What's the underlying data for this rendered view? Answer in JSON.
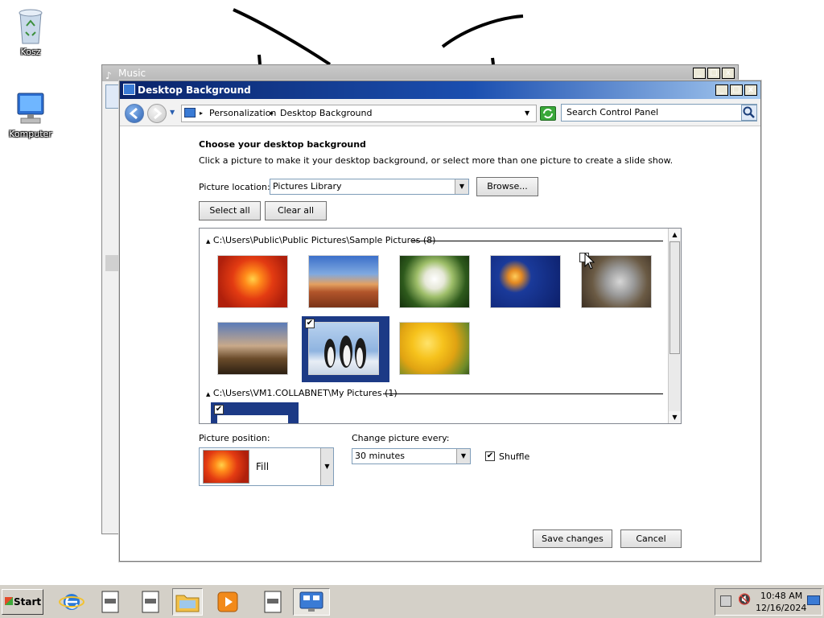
{
  "desktop": {
    "icons": [
      {
        "label": "Kosz",
        "icon": "recycle-bin-icon"
      },
      {
        "label": "Komputer",
        "icon": "computer-icon"
      }
    ]
  },
  "music_window": {
    "title": "Music",
    "buttons": [
      "_",
      "□",
      "x"
    ]
  },
  "window": {
    "title": "Desktop Background",
    "buttons": [
      "_",
      "□",
      "x"
    ]
  },
  "address_bar": {
    "breadcrumbs": [
      "Personalization",
      "Desktop Background"
    ],
    "search_placeholder": "Search Control Panel"
  },
  "content": {
    "heading": "Choose your desktop background",
    "description": "Click a picture to make it your desktop background, or select more than one picture to create a slide show.",
    "picture_location_label": "Picture location:",
    "picture_location_value": "Pictures Library",
    "browse_label": "Browse...",
    "select_all_label": "Select all",
    "clear_all_label": "Clear all",
    "groups": [
      {
        "label": "C:\\Users\\Public\\Public Pictures\\Sample Pictures (8)"
      },
      {
        "label": "C:\\Users\\VM1.COLLABNET\\My Pictures (1)"
      }
    ],
    "thumbnails": [
      {
        "name": "Chrysanthemum",
        "selected": false,
        "checked": false
      },
      {
        "name": "Desert",
        "selected": false,
        "checked": false
      },
      {
        "name": "Hydrangeas",
        "selected": false,
        "checked": false
      },
      {
        "name": "Jellyfish",
        "selected": false,
        "checked": false
      },
      {
        "name": "Koala",
        "selected": false,
        "checked": false
      },
      {
        "name": "Lighthouse",
        "selected": false,
        "checked": false
      },
      {
        "name": "Penguins",
        "selected": true,
        "checked": true
      },
      {
        "name": "Tulips",
        "selected": false,
        "checked": false
      },
      {
        "name": "My picture",
        "selected": true,
        "checked": true
      }
    ],
    "picture_position_label": "Picture position:",
    "picture_position_value": "Fill",
    "change_every_label": "Change picture every:",
    "change_every_value": "30 minutes",
    "shuffle_label": "Shuffle",
    "shuffle_checked": true,
    "save_label": "Save changes",
    "cancel_label": "Cancel"
  },
  "taskbar": {
    "start_label": "Start",
    "time": "10:48 AM",
    "date": "12/16/2024"
  },
  "colors": {
    "accent": "#1c3a86",
    "titlebar": "#0a246a"
  }
}
